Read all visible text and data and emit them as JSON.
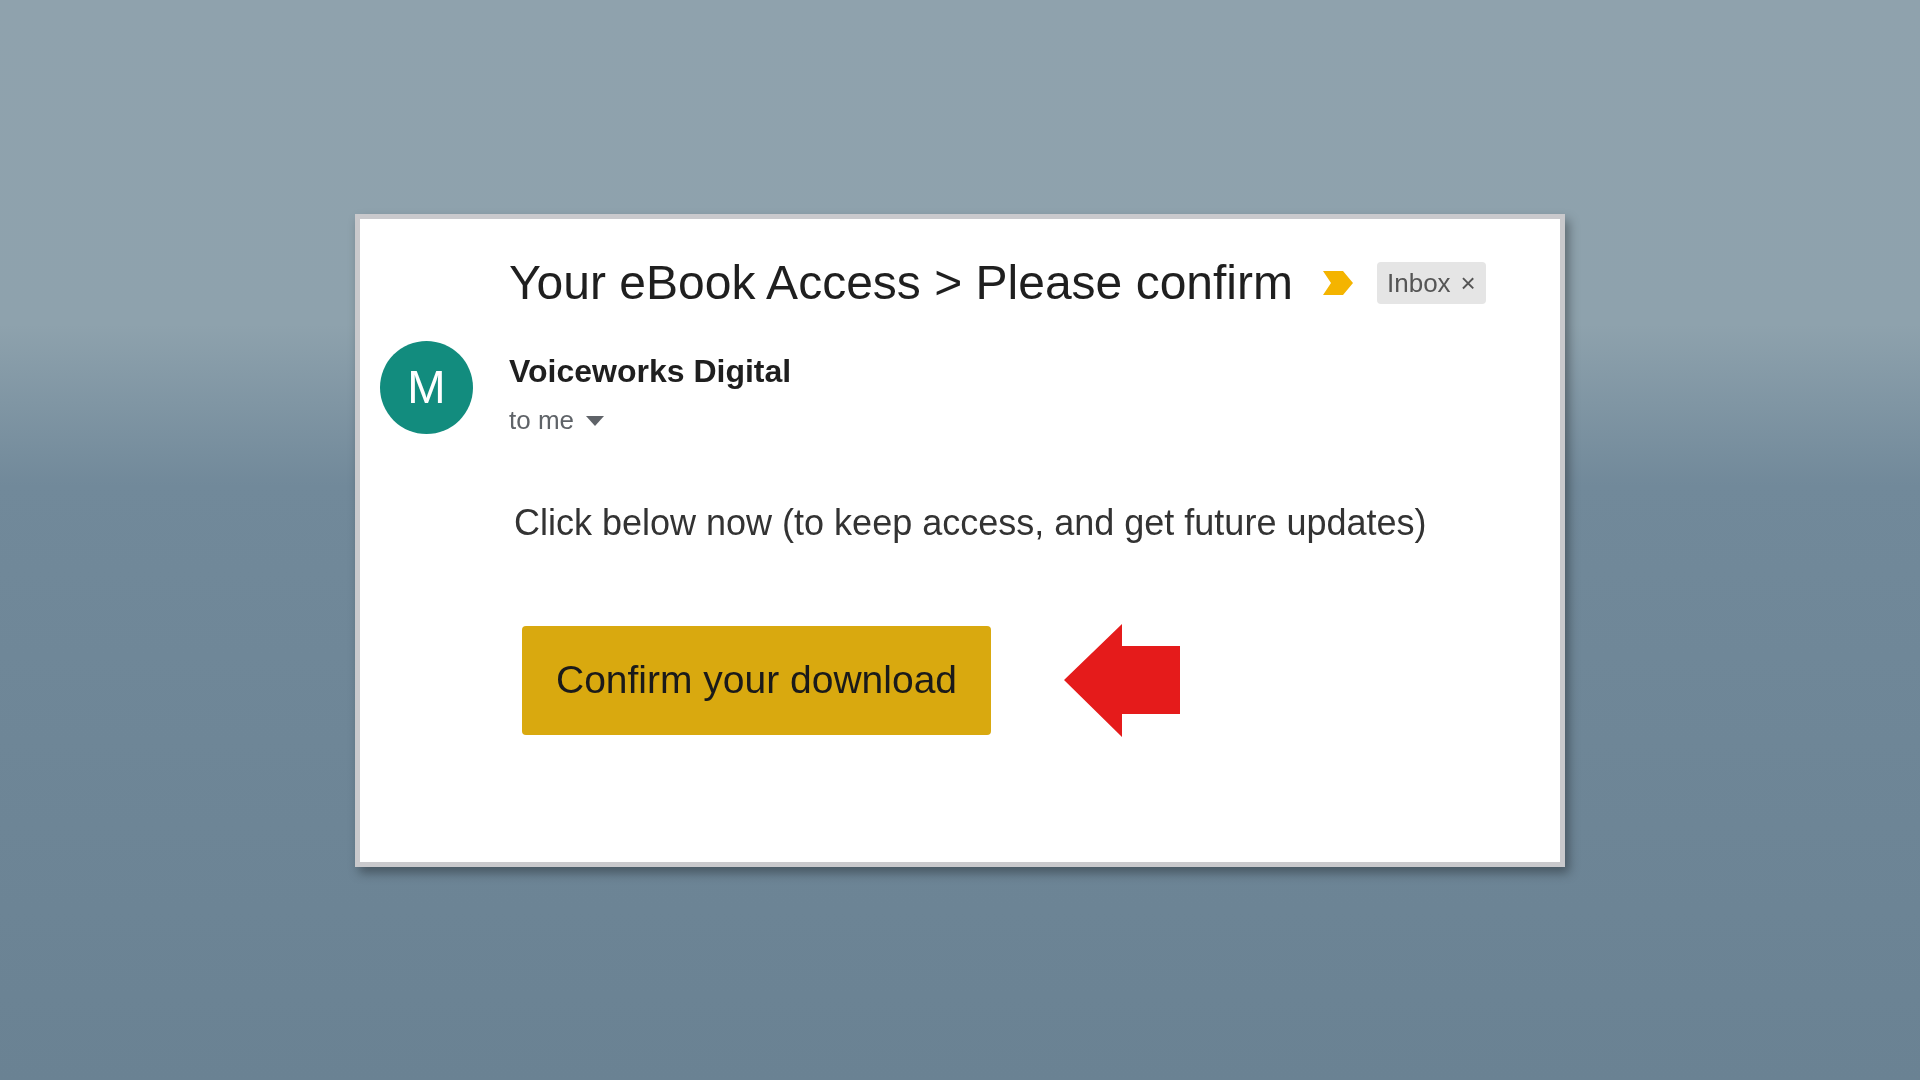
{
  "email": {
    "subject": "Your eBook Access > Please confirm",
    "important": true,
    "label": {
      "text": "Inbox",
      "close": "×"
    },
    "sender": {
      "initial": "M",
      "name": "Voiceworks Digital",
      "recipient": "to me"
    },
    "body": "Click below now (to keep access, and get future updates)",
    "button": "Confirm your download"
  }
}
